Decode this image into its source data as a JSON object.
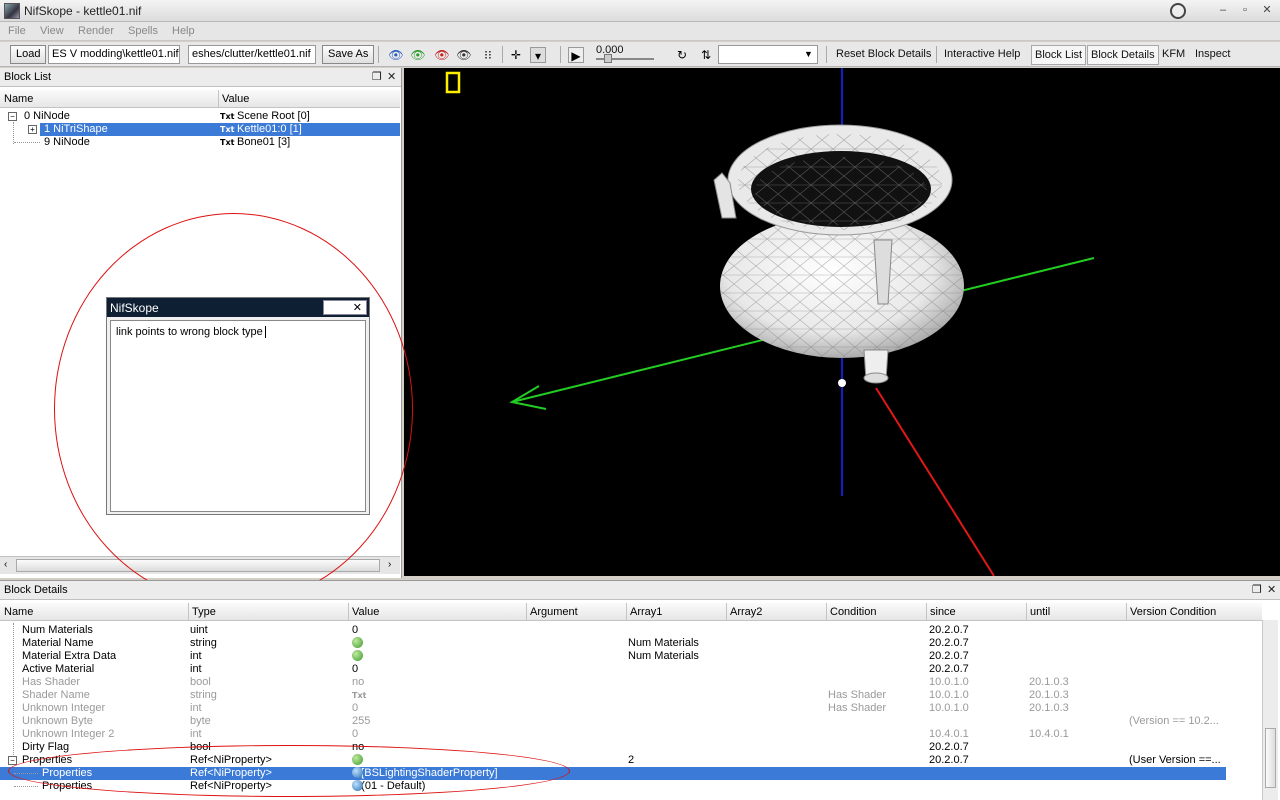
{
  "window": {
    "title": "NifSkope - kettle01.nif",
    "controls": {
      "minimize": "–",
      "restore": "▫",
      "close": "✕"
    }
  },
  "menu": [
    "File",
    "View",
    "Render",
    "Spells",
    "Help"
  ],
  "toolbar": {
    "load_label": "Load",
    "load_path": "ES V modding\\kettle01.nif",
    "save_path": "eshes/clutter/kettle01.nif",
    "save_as_label": "Save As",
    "time_value": "0.000",
    "animation_select": "",
    "reset_block_details": "Reset Block Details",
    "interactive_help": "Interactive Help",
    "block_list": "Block List",
    "block_details": "Block Details",
    "kfm": "KFM",
    "inspect": "Inspect"
  },
  "block_list": {
    "title": "Block List",
    "columns": [
      "Name",
      "Value"
    ],
    "rows": [
      {
        "name": "0 NiNode",
        "value": "Scene Root [0]",
        "expander": "−"
      },
      {
        "name": "1 NiTriShape",
        "value": "Kettle01:0 [1]",
        "expander": "+"
      },
      {
        "name": "9 NiNode",
        "value": "Bone01 [3]",
        "expander": ""
      }
    ],
    "txt_icon": "Txt"
  },
  "dialog": {
    "title": "NifSkope",
    "close": "✕",
    "message": "link points to wrong block type"
  },
  "block_details": {
    "title": "Block Details",
    "columns": [
      "Name",
      "Type",
      "Value",
      "Argument",
      "Array1",
      "Array2",
      "Condition",
      "since",
      "until",
      "Version Condition"
    ],
    "rows": [
      {
        "name": "Num Materials",
        "type": "uint",
        "value": "0",
        "array1": "",
        "condition": "",
        "since": "20.2.0.7",
        "until": "",
        "vcond": "",
        "dim": false,
        "icon": ""
      },
      {
        "name": "Material Name",
        "type": "string",
        "value": "",
        "array1": "Num Materials",
        "condition": "",
        "since": "20.2.0.7",
        "until": "",
        "vcond": "",
        "dim": false,
        "icon": "green"
      },
      {
        "name": "Material Extra Data",
        "type": "int",
        "value": "",
        "array1": "Num Materials",
        "condition": "",
        "since": "20.2.0.7",
        "until": "",
        "vcond": "",
        "dim": false,
        "icon": "green"
      },
      {
        "name": "Active Material",
        "type": "int",
        "value": "0",
        "array1": "",
        "condition": "",
        "since": "20.2.0.7",
        "until": "",
        "vcond": "",
        "dim": false,
        "icon": ""
      },
      {
        "name": "Has Shader",
        "type": "bool",
        "value": "no",
        "array1": "",
        "condition": "",
        "since": "10.0.1.0",
        "until": "20.1.0.3",
        "vcond": "",
        "dim": true,
        "icon": ""
      },
      {
        "name": "Shader Name",
        "type": "string",
        "value": "Txt",
        "array1": "",
        "condition": "Has Shader",
        "since": "10.0.1.0",
        "until": "20.1.0.3",
        "vcond": "",
        "dim": true,
        "icon": ""
      },
      {
        "name": "Unknown Integer",
        "type": "int",
        "value": "0",
        "array1": "",
        "condition": "Has Shader",
        "since": "10.0.1.0",
        "until": "20.1.0.3",
        "vcond": "",
        "dim": true,
        "icon": ""
      },
      {
        "name": "Unknown Byte",
        "type": "byte",
        "value": "255",
        "array1": "",
        "condition": "",
        "since": "",
        "until": "",
        "vcond": "(Version == 10.2...",
        "dim": true,
        "icon": ""
      },
      {
        "name": "Unknown Integer 2",
        "type": "int",
        "value": "0",
        "array1": "",
        "condition": "",
        "since": "10.4.0.1",
        "until": "10.4.0.1",
        "vcond": "",
        "dim": true,
        "icon": ""
      },
      {
        "name": "Dirty Flag",
        "type": "bool",
        "value": "no",
        "array1": "",
        "condition": "",
        "since": "20.2.0.7",
        "until": "",
        "vcond": "",
        "dim": false,
        "icon": ""
      },
      {
        "name": "Properties",
        "type": "Ref<NiProperty>",
        "value": "",
        "array1": "2",
        "condition": "",
        "since": "20.2.0.7",
        "until": "",
        "vcond": "(User Version ==...",
        "dim": false,
        "icon": "green"
      },
      {
        "name": "Properties",
        "type": "Ref<NiProperty>",
        "value": "6 [BSLightingShaderProperty]",
        "array1": "",
        "condition": "",
        "since": "",
        "until": "",
        "vcond": "",
        "dim": false,
        "icon": "link",
        "selected": true
      },
      {
        "name": "Properties",
        "type": "Ref<NiProperty>",
        "value": "8 (01 - Default)",
        "array1": "",
        "condition": "",
        "since": "",
        "until": "",
        "vcond": "",
        "dim": false,
        "icon": "link"
      }
    ]
  },
  "colors": {
    "selection": "#3b7ad6",
    "annotation": "#d11111",
    "dialog_title": "#0e1e33",
    "axis_x": "#e01818",
    "axis_y": "#22cc22",
    "axis_z": "#1020c8"
  }
}
